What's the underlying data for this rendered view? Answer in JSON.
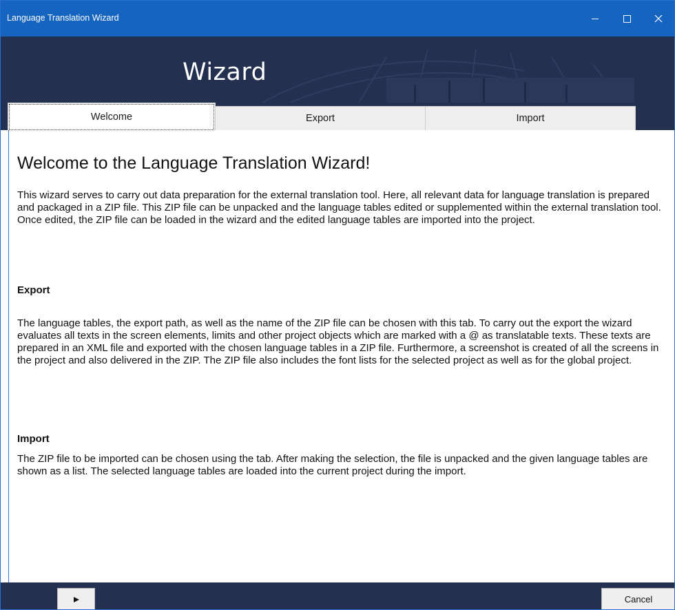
{
  "window": {
    "title": "Language Translation Wizard",
    "controls": [
      "minimize-icon",
      "maximize-icon",
      "close-icon"
    ]
  },
  "banner": {
    "title": "Wizard"
  },
  "tabs": [
    {
      "label": "Welcome",
      "selected": true
    },
    {
      "label": "Export",
      "selected": false
    },
    {
      "label": "Import",
      "selected": false
    }
  ],
  "content": {
    "heading": "Welcome to the Language Translation Wizard!",
    "intro": "This wizard serves to carry out data preparation for the external translation tool. Here, all relevant data for language translation is prepared and packaged in a ZIP file. This ZIP file can be unpacked and the language tables edited or supplemented within the external translation tool. Once edited, the ZIP file can be loaded in the wizard and the edited language tables are imported into the project.",
    "export_heading": "Export",
    "export_text": "The language tables, the export path, as well as the name of the ZIP file can be chosen with this tab. To carry out the export the wizard evaluates all texts in the screen elements, limits and other project objects which are marked with a @ as translatable texts.  These texts are prepared in an XML file and exported with the chosen language tables in a ZIP file. Furthermore, a screenshot is created of all the screens in the project and also delivered in the ZIP. The ZIP file also includes the font lists for the selected project as well as for the global project.",
    "import_heading": "Import",
    "import_text": "The ZIP file to be imported can be chosen using the tab. After making the selection, the file is unpacked and the given language tables are shown as a list. The selected language tables are loaded into the current project during the import."
  },
  "footer": {
    "next_icon": "play-icon",
    "cancel_label": "Cancel"
  },
  "colors": {
    "titlebar": "#1565c0",
    "banner": "#23304f",
    "tab_inactive": "#eeeeee",
    "tab_active": "#ffffff"
  }
}
